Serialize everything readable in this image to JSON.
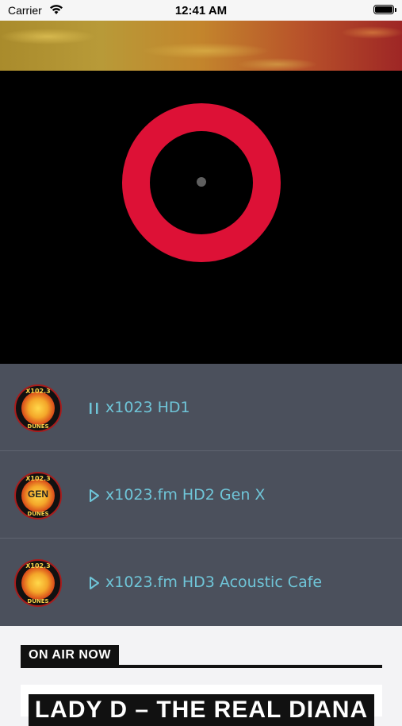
{
  "status_bar": {
    "carrier": "Carrier",
    "time": "12:41 AM"
  },
  "stations": [
    {
      "label": "x1023 HD1",
      "state": "playing",
      "control_icon": "pause-icon",
      "logo": {
        "top": "X102.3",
        "bottom": "DUNES",
        "mark": ""
      }
    },
    {
      "label": "x1023.fm HD2 Gen X",
      "state": "stopped",
      "control_icon": "play-icon",
      "logo": {
        "top": "X102.3",
        "bottom": "DUNES",
        "mark": "GEN"
      }
    },
    {
      "label": "x1023.fm HD3 Acoustic Cafe",
      "state": "stopped",
      "control_icon": "play-icon",
      "logo": {
        "top": "X102.3",
        "bottom": "DUNES",
        "mark": ""
      }
    }
  ],
  "on_air": {
    "heading": "ON AIR NOW",
    "show_title": "LADY D – THE REAL DIANA"
  },
  "colors": {
    "ring": "#dd1136",
    "station_bg": "#4b505c",
    "station_text": "#6fc5d8"
  }
}
